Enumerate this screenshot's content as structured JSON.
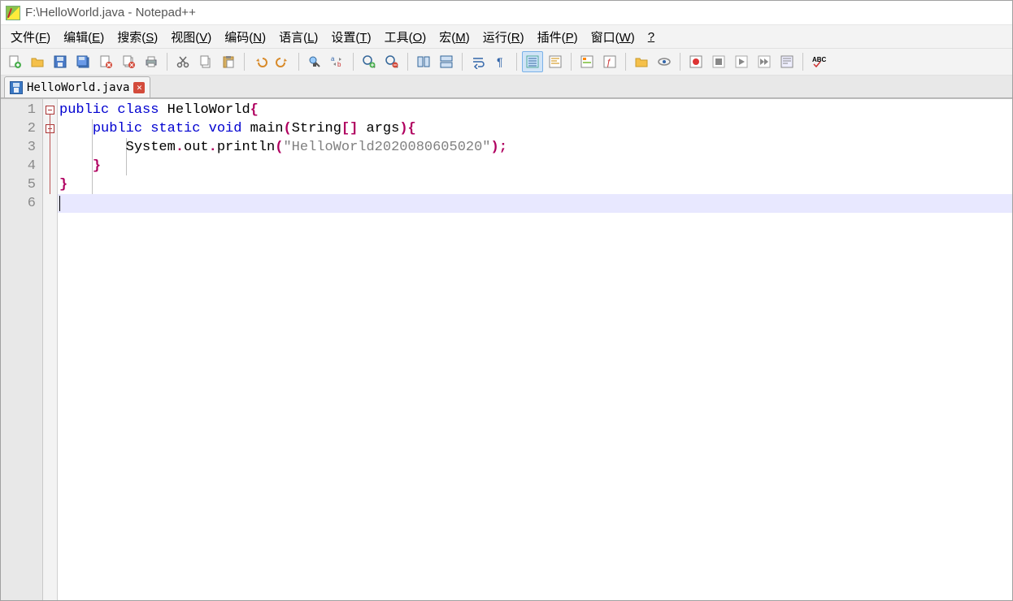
{
  "title": "F:\\HelloWorld.java - Notepad++",
  "menus": [
    {
      "label": "文件(",
      "u": "F",
      "tail": ")"
    },
    {
      "label": "编辑(",
      "u": "E",
      "tail": ")"
    },
    {
      "label": "搜索(",
      "u": "S",
      "tail": ")"
    },
    {
      "label": "视图(",
      "u": "V",
      "tail": ")"
    },
    {
      "label": "编码(",
      "u": "N",
      "tail": ")"
    },
    {
      "label": "语言(",
      "u": "L",
      "tail": ")"
    },
    {
      "label": "设置(",
      "u": "T",
      "tail": ")"
    },
    {
      "label": "工具(",
      "u": "O",
      "tail": ")"
    },
    {
      "label": "宏(",
      "u": "M",
      "tail": ")"
    },
    {
      "label": "运行(",
      "u": "R",
      "tail": ")"
    },
    {
      "label": "插件(",
      "u": "P",
      "tail": ")"
    },
    {
      "label": "窗口(",
      "u": "W",
      "tail": ")"
    },
    {
      "label": "",
      "u": "?",
      "tail": ""
    }
  ],
  "toolbar": [
    {
      "name": "new-file-icon",
      "glyph": "new"
    },
    {
      "name": "open-file-icon",
      "glyph": "open"
    },
    {
      "name": "save-icon",
      "glyph": "save"
    },
    {
      "name": "save-all-icon",
      "glyph": "saveall"
    },
    {
      "name": "close-icon",
      "glyph": "close"
    },
    {
      "name": "close-all-icon",
      "glyph": "closeall"
    },
    {
      "name": "print-icon",
      "glyph": "print"
    },
    {
      "sep": true
    },
    {
      "name": "cut-icon",
      "glyph": "cut"
    },
    {
      "name": "copy-icon",
      "glyph": "copy"
    },
    {
      "name": "paste-icon",
      "glyph": "paste"
    },
    {
      "sep": true
    },
    {
      "name": "undo-icon",
      "glyph": "undo"
    },
    {
      "name": "redo-icon",
      "glyph": "redo"
    },
    {
      "sep": true
    },
    {
      "name": "find-icon",
      "glyph": "find"
    },
    {
      "name": "replace-icon",
      "glyph": "replace"
    },
    {
      "sep": true
    },
    {
      "name": "zoom-in-icon",
      "glyph": "zoomin"
    },
    {
      "name": "zoom-out-icon",
      "glyph": "zoomout"
    },
    {
      "sep": true
    },
    {
      "name": "sync-v-icon",
      "glyph": "syncv"
    },
    {
      "name": "sync-h-icon",
      "glyph": "synch"
    },
    {
      "sep": true
    },
    {
      "name": "wordwrap-icon",
      "glyph": "wrap"
    },
    {
      "name": "show-all-chars-icon",
      "glyph": "pilcrow"
    },
    {
      "sep": true
    },
    {
      "name": "indent-guide-icon",
      "glyph": "indent",
      "active": true
    },
    {
      "name": "user-lang-icon",
      "glyph": "lang"
    },
    {
      "sep": true
    },
    {
      "name": "doc-map-icon",
      "glyph": "map"
    },
    {
      "name": "func-list-icon",
      "glyph": "func"
    },
    {
      "sep": true
    },
    {
      "name": "folder-icon",
      "glyph": "folder"
    },
    {
      "name": "monitor-icon",
      "glyph": "eye"
    },
    {
      "sep": true
    },
    {
      "name": "record-macro-icon",
      "glyph": "rec"
    },
    {
      "name": "stop-macro-icon",
      "glyph": "stop"
    },
    {
      "name": "play-macro-icon",
      "glyph": "play"
    },
    {
      "name": "play-multi-icon",
      "glyph": "fast"
    },
    {
      "name": "save-macro-icon",
      "glyph": "savemac"
    },
    {
      "sep": true
    },
    {
      "name": "spellcheck-icon",
      "glyph": "abc"
    }
  ],
  "tab": {
    "label": "HelloWorld.java"
  },
  "code": {
    "line_count": 6,
    "highlight_line": 6,
    "lines": [
      {
        "tokens": [
          {
            "t": "public",
            "c": "kw"
          },
          {
            "t": " ",
            "c": "ident"
          },
          {
            "t": "class",
            "c": "kw"
          },
          {
            "t": " HelloWorld",
            "c": "ident"
          },
          {
            "t": "{",
            "c": "paren"
          }
        ]
      },
      {
        "indent": 1,
        "tokens": [
          {
            "t": "    ",
            "c": "ident"
          },
          {
            "t": "public",
            "c": "kw"
          },
          {
            "t": " ",
            "c": "ident"
          },
          {
            "t": "static",
            "c": "kw"
          },
          {
            "t": " ",
            "c": "ident"
          },
          {
            "t": "void",
            "c": "kw"
          },
          {
            "t": " main",
            "c": "ident"
          },
          {
            "t": "(",
            "c": "paren"
          },
          {
            "t": "String",
            "c": "ident"
          },
          {
            "t": "[]",
            "c": "paren"
          },
          {
            "t": " args",
            "c": "ident"
          },
          {
            "t": "){",
            "c": "paren"
          }
        ]
      },
      {
        "indent": 2,
        "tokens": [
          {
            "t": "        System",
            "c": "ident"
          },
          {
            "t": ".",
            "c": "paren"
          },
          {
            "t": "out",
            "c": "ident"
          },
          {
            "t": ".",
            "c": "paren"
          },
          {
            "t": "println",
            "c": "ident"
          },
          {
            "t": "(",
            "c": "paren"
          },
          {
            "t": "\"HelloWorld2020080605020\"",
            "c": "str"
          },
          {
            "t": ");",
            "c": "paren"
          }
        ]
      },
      {
        "indent": 1,
        "tokens": [
          {
            "t": "    ",
            "c": "ident"
          },
          {
            "t": "}",
            "c": "paren"
          }
        ]
      },
      {
        "indent": 0,
        "tokens": [
          {
            "t": "}",
            "c": "paren"
          }
        ]
      },
      {
        "tokens": []
      }
    ]
  }
}
